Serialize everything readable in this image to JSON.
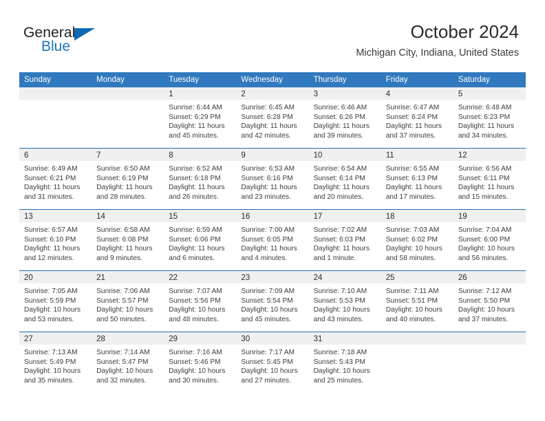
{
  "brand": {
    "name_part1": "General",
    "name_part2": "Blue",
    "colors": {
      "dark": "#231f20",
      "blue": "#1b74bd",
      "header_blue": "#3179be",
      "rule_blue": "#1f6fb5",
      "daynum_band": "#f0f0f0"
    }
  },
  "header": {
    "title": "October 2024",
    "subtitle": "Michigan City, Indiana, United States"
  },
  "calendar": {
    "weekday_headers": [
      "Sunday",
      "Monday",
      "Tuesday",
      "Wednesday",
      "Thursday",
      "Friday",
      "Saturday"
    ],
    "labels": {
      "sunrise": "Sunrise:",
      "sunset": "Sunset:",
      "daylight": "Daylight:"
    },
    "weeks": [
      [
        {
          "day": "",
          "empty": true,
          "sunrise": "",
          "sunset": "",
          "daylight_line1": "",
          "daylight_line2": ""
        },
        {
          "day": "",
          "empty": true,
          "sunrise": "",
          "sunset": "",
          "daylight_line1": "",
          "daylight_line2": ""
        },
        {
          "day": "1",
          "empty": false,
          "sunrise": "Sunrise: 6:44 AM",
          "sunset": "Sunset: 6:29 PM",
          "daylight_line1": "Daylight: 11 hours",
          "daylight_line2": "and 45 minutes."
        },
        {
          "day": "2",
          "empty": false,
          "sunrise": "Sunrise: 6:45 AM",
          "sunset": "Sunset: 6:28 PM",
          "daylight_line1": "Daylight: 11 hours",
          "daylight_line2": "and 42 minutes."
        },
        {
          "day": "3",
          "empty": false,
          "sunrise": "Sunrise: 6:46 AM",
          "sunset": "Sunset: 6:26 PM",
          "daylight_line1": "Daylight: 11 hours",
          "daylight_line2": "and 39 minutes."
        },
        {
          "day": "4",
          "empty": false,
          "sunrise": "Sunrise: 6:47 AM",
          "sunset": "Sunset: 6:24 PM",
          "daylight_line1": "Daylight: 11 hours",
          "daylight_line2": "and 37 minutes."
        },
        {
          "day": "5",
          "empty": false,
          "sunrise": "Sunrise: 6:48 AM",
          "sunset": "Sunset: 6:23 PM",
          "daylight_line1": "Daylight: 11 hours",
          "daylight_line2": "and 34 minutes."
        }
      ],
      [
        {
          "day": "6",
          "empty": false,
          "sunrise": "Sunrise: 6:49 AM",
          "sunset": "Sunset: 6:21 PM",
          "daylight_line1": "Daylight: 11 hours",
          "daylight_line2": "and 31 minutes."
        },
        {
          "day": "7",
          "empty": false,
          "sunrise": "Sunrise: 6:50 AM",
          "sunset": "Sunset: 6:19 PM",
          "daylight_line1": "Daylight: 11 hours",
          "daylight_line2": "and 28 minutes."
        },
        {
          "day": "8",
          "empty": false,
          "sunrise": "Sunrise: 6:52 AM",
          "sunset": "Sunset: 6:18 PM",
          "daylight_line1": "Daylight: 11 hours",
          "daylight_line2": "and 26 minutes."
        },
        {
          "day": "9",
          "empty": false,
          "sunrise": "Sunrise: 6:53 AM",
          "sunset": "Sunset: 6:16 PM",
          "daylight_line1": "Daylight: 11 hours",
          "daylight_line2": "and 23 minutes."
        },
        {
          "day": "10",
          "empty": false,
          "sunrise": "Sunrise: 6:54 AM",
          "sunset": "Sunset: 6:14 PM",
          "daylight_line1": "Daylight: 11 hours",
          "daylight_line2": "and 20 minutes."
        },
        {
          "day": "11",
          "empty": false,
          "sunrise": "Sunrise: 6:55 AM",
          "sunset": "Sunset: 6:13 PM",
          "daylight_line1": "Daylight: 11 hours",
          "daylight_line2": "and 17 minutes."
        },
        {
          "day": "12",
          "empty": false,
          "sunrise": "Sunrise: 6:56 AM",
          "sunset": "Sunset: 6:11 PM",
          "daylight_line1": "Daylight: 11 hours",
          "daylight_line2": "and 15 minutes."
        }
      ],
      [
        {
          "day": "13",
          "empty": false,
          "sunrise": "Sunrise: 6:57 AM",
          "sunset": "Sunset: 6:10 PM",
          "daylight_line1": "Daylight: 11 hours",
          "daylight_line2": "and 12 minutes."
        },
        {
          "day": "14",
          "empty": false,
          "sunrise": "Sunrise: 6:58 AM",
          "sunset": "Sunset: 6:08 PM",
          "daylight_line1": "Daylight: 11 hours",
          "daylight_line2": "and 9 minutes."
        },
        {
          "day": "15",
          "empty": false,
          "sunrise": "Sunrise: 6:59 AM",
          "sunset": "Sunset: 6:06 PM",
          "daylight_line1": "Daylight: 11 hours",
          "daylight_line2": "and 6 minutes."
        },
        {
          "day": "16",
          "empty": false,
          "sunrise": "Sunrise: 7:00 AM",
          "sunset": "Sunset: 6:05 PM",
          "daylight_line1": "Daylight: 11 hours",
          "daylight_line2": "and 4 minutes."
        },
        {
          "day": "17",
          "empty": false,
          "sunrise": "Sunrise: 7:02 AM",
          "sunset": "Sunset: 6:03 PM",
          "daylight_line1": "Daylight: 11 hours",
          "daylight_line2": "and 1 minute."
        },
        {
          "day": "18",
          "empty": false,
          "sunrise": "Sunrise: 7:03 AM",
          "sunset": "Sunset: 6:02 PM",
          "daylight_line1": "Daylight: 10 hours",
          "daylight_line2": "and 58 minutes."
        },
        {
          "day": "19",
          "empty": false,
          "sunrise": "Sunrise: 7:04 AM",
          "sunset": "Sunset: 6:00 PM",
          "daylight_line1": "Daylight: 10 hours",
          "daylight_line2": "and 56 minutes."
        }
      ],
      [
        {
          "day": "20",
          "empty": false,
          "sunrise": "Sunrise: 7:05 AM",
          "sunset": "Sunset: 5:59 PM",
          "daylight_line1": "Daylight: 10 hours",
          "daylight_line2": "and 53 minutes."
        },
        {
          "day": "21",
          "empty": false,
          "sunrise": "Sunrise: 7:06 AM",
          "sunset": "Sunset: 5:57 PM",
          "daylight_line1": "Daylight: 10 hours",
          "daylight_line2": "and 50 minutes."
        },
        {
          "day": "22",
          "empty": false,
          "sunrise": "Sunrise: 7:07 AM",
          "sunset": "Sunset: 5:56 PM",
          "daylight_line1": "Daylight: 10 hours",
          "daylight_line2": "and 48 minutes."
        },
        {
          "day": "23",
          "empty": false,
          "sunrise": "Sunrise: 7:09 AM",
          "sunset": "Sunset: 5:54 PM",
          "daylight_line1": "Daylight: 10 hours",
          "daylight_line2": "and 45 minutes."
        },
        {
          "day": "24",
          "empty": false,
          "sunrise": "Sunrise: 7:10 AM",
          "sunset": "Sunset: 5:53 PM",
          "daylight_line1": "Daylight: 10 hours",
          "daylight_line2": "and 43 minutes."
        },
        {
          "day": "25",
          "empty": false,
          "sunrise": "Sunrise: 7:11 AM",
          "sunset": "Sunset: 5:51 PM",
          "daylight_line1": "Daylight: 10 hours",
          "daylight_line2": "and 40 minutes."
        },
        {
          "day": "26",
          "empty": false,
          "sunrise": "Sunrise: 7:12 AM",
          "sunset": "Sunset: 5:50 PM",
          "daylight_line1": "Daylight: 10 hours",
          "daylight_line2": "and 37 minutes."
        }
      ],
      [
        {
          "day": "27",
          "empty": false,
          "sunrise": "Sunrise: 7:13 AM",
          "sunset": "Sunset: 5:49 PM",
          "daylight_line1": "Daylight: 10 hours",
          "daylight_line2": "and 35 minutes."
        },
        {
          "day": "28",
          "empty": false,
          "sunrise": "Sunrise: 7:14 AM",
          "sunset": "Sunset: 5:47 PM",
          "daylight_line1": "Daylight: 10 hours",
          "daylight_line2": "and 32 minutes."
        },
        {
          "day": "29",
          "empty": false,
          "sunrise": "Sunrise: 7:16 AM",
          "sunset": "Sunset: 5:46 PM",
          "daylight_line1": "Daylight: 10 hours",
          "daylight_line2": "and 30 minutes."
        },
        {
          "day": "30",
          "empty": false,
          "sunrise": "Sunrise: 7:17 AM",
          "sunset": "Sunset: 5:45 PM",
          "daylight_line1": "Daylight: 10 hours",
          "daylight_line2": "and 27 minutes."
        },
        {
          "day": "31",
          "empty": false,
          "sunrise": "Sunrise: 7:18 AM",
          "sunset": "Sunset: 5:43 PM",
          "daylight_line1": "Daylight: 10 hours",
          "daylight_line2": "and 25 minutes."
        },
        {
          "day": "",
          "empty": true,
          "sunrise": "",
          "sunset": "",
          "daylight_line1": "",
          "daylight_line2": ""
        },
        {
          "day": "",
          "empty": true,
          "sunrise": "",
          "sunset": "",
          "daylight_line1": "",
          "daylight_line2": ""
        }
      ]
    ]
  }
}
